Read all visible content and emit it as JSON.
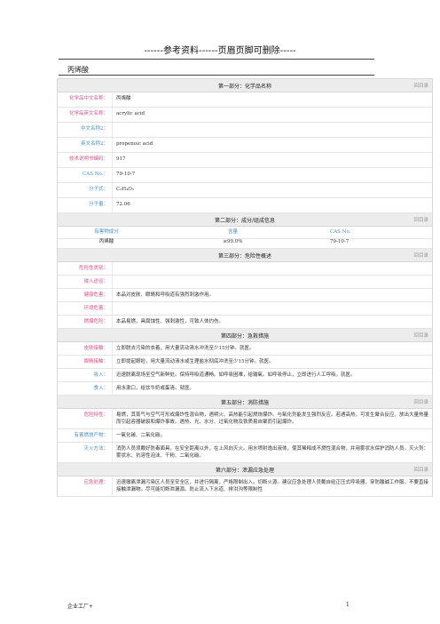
{
  "banner": "------参考资料------页眉页脚可删除-----",
  "doc_title": "丙烯酸",
  "back_label": "回目录",
  "sections": {
    "s1": "第一部分：化学品名称",
    "s2": "第二部分：成分/组成信息",
    "s3": "第三部分：危险性概述",
    "s4": "第四部分：急救措施",
    "s5": "第五部分：消防措施",
    "s6": "第六部分：泄漏应急处理"
  },
  "name_rows": [
    {
      "label": "化学品中文名称：",
      "value": "丙烯酸"
    },
    {
      "label": "化学品英文名称：",
      "value": "acrylic acid"
    },
    {
      "label": "中文名称2：",
      "value": ""
    },
    {
      "label": "英文名称2：",
      "value": "propenoic acid"
    },
    {
      "label": "技术说明书编码：",
      "value": "917"
    },
    {
      "label": "CAS No.：",
      "value": "79-10-7"
    },
    {
      "label": "分子式：",
      "value": "C₃H₄O₂"
    },
    {
      "label": "分子量：",
      "value": "72.06"
    }
  ],
  "composition": {
    "headers": [
      "有害物成分",
      "含量",
      "CAS No."
    ],
    "row": [
      "丙烯酸",
      "≥99.0%",
      "79-10-7"
    ]
  },
  "hazard_rows": [
    {
      "label": "危险性类别：",
      "value": ""
    },
    {
      "label": "侵入途径：",
      "value": ""
    },
    {
      "label": "健康危害：",
      "value": "本品对皮肤、眼睛和呼吸道有强烈刺激作用。"
    },
    {
      "label": "环境危害：",
      "value": ""
    },
    {
      "label": "燃爆危险：",
      "value": "本品易燃，具腐蚀性、强刺激性，可致人体灼伤。"
    }
  ],
  "firstaid_rows": [
    {
      "label": "皮肤接触：",
      "value": "立即脱去污染的衣着，用大量流动清水冲洗至少15分钟。就医。"
    },
    {
      "label": "眼睛接触：",
      "value": "立即提起眼睑，用大量流动清水或生理盐水彻底冲洗至少15分钟。就医。"
    },
    {
      "label": "吸入：",
      "value": "迅速脱离现场至空气新鲜处。保持呼吸道通畅。如呼吸困难，给输氧。如呼吸停止，立即进行人工呼吸。就医。"
    },
    {
      "label": "食入：",
      "value": "用水漱口，给饮牛奶或蛋清。就医。"
    }
  ],
  "fire_rows": [
    {
      "label": "危险特性：",
      "value": "易燃，其蒸气与空气可形成爆炸性混合物，遇明火、高热能引起燃烧爆炸。与氧化剂能发生强烈反应。若遇高热，可发生聚合反应，放出大量热量而引起容器破裂和爆炸事故。遇热、光、水分、过氧化物及铁质易自聚而引起爆炸。"
    },
    {
      "label": "有害燃烧产物：",
      "value": "一氧化碳、二氧化碳。"
    },
    {
      "label": "灭火方法：",
      "value": "消防人员须戴好防毒面具，在安全距离以外，在上风向灭火。用水喷射逸出液体，使其稀释成不燃性混合物，并用雾状水保护消防人员。灭火剂：雾状水、抗溶性泡沫、干粉、二氧化碳。"
    }
  ],
  "leak_rows": [
    {
      "label": "应急处理：",
      "value": "迅速撤离泄漏污染区人员至安全区，并进行隔离，严格限制出入。切断火源。建议应急处理人员戴自给正压式呼吸器，穿防酸碱工作服。不要直接接触泄漏物。尽可能切断泄漏源。防止流入下水道、排洪沟等限制性"
    }
  ],
  "footer_left": "企业工厂+",
  "footer_right": "1"
}
